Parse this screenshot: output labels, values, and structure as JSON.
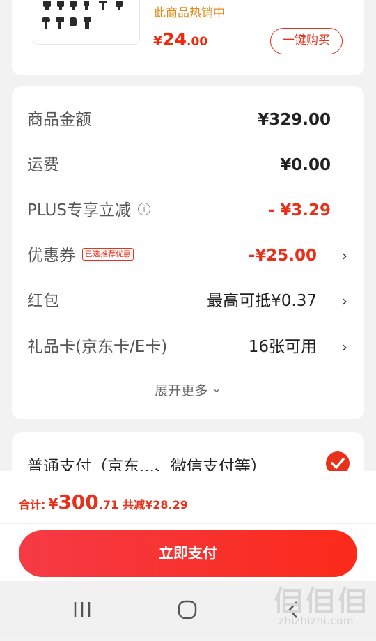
{
  "product": {
    "hot_text": "此商品热销中",
    "price_currency": "¥",
    "price_int": "24",
    "price_dec": ".00",
    "buy_button": "一键购买"
  },
  "summary": {
    "rows": [
      {
        "label": "商品金额",
        "value": "¥329.00"
      },
      {
        "label": "运费",
        "value": "¥0.00"
      },
      {
        "label": "PLUS专享立减",
        "value": "- ¥3.29",
        "info_icon": "info-icon"
      },
      {
        "label": "优惠券",
        "tag": "已选推荐优惠",
        "value": "-¥25.00"
      },
      {
        "label": "红包",
        "value": "最高可抵¥0.37"
      },
      {
        "label": "礼品卡(京东卡/E卡)",
        "value": "16张可用"
      }
    ],
    "expand_more": "展开更多",
    "chevron": "›",
    "expand_chevron": "⌄"
  },
  "payment": {
    "method_label": "普通支付（京东...、微信支付等）",
    "selected": true
  },
  "footer": {
    "total_label": "合计:",
    "total_currency": "¥",
    "total_int": "300",
    "total_dec": ".71",
    "savings": "共减¥28.29",
    "pay_button": "立即支付"
  },
  "navbar": {
    "recent_icon": "recent-apps-icon",
    "home_icon": "home-icon",
    "back_icon": "back-icon"
  },
  "watermark": {
    "logo_text": "值值值",
    "site": "zhizhizhi.com"
  },
  "colors": {
    "accent": "#e8311a",
    "hot": "#e08a1e",
    "background": "#f2f2f2"
  }
}
